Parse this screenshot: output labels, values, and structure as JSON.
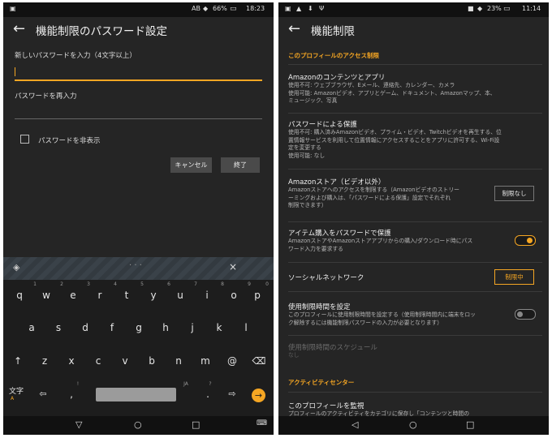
{
  "left": {
    "status": {
      "indicators": "AB",
      "battery": "66%",
      "time": "18:23"
    },
    "title": "機能制限のパスワード設定",
    "new_password_label": "新しいパスワードを入力（4文字以上）",
    "reenter_label": "パスワードを再入力",
    "hide_password_label": "パスワードを非表示",
    "cancel": "キャンセル",
    "finish": "終了",
    "keyboard": {
      "close": "×",
      "row1": [
        "q",
        "w",
        "e",
        "r",
        "t",
        "y",
        "u",
        "i",
        "o",
        "p"
      ],
      "row1_hints": [
        "1",
        "2",
        "3",
        "4",
        "5",
        "6",
        "7",
        "8",
        "9",
        "0"
      ],
      "row2": [
        "a",
        "s",
        "d",
        "f",
        "g",
        "h",
        "j",
        "k",
        "l"
      ],
      "row3": [
        "↑",
        "z",
        "x",
        "c",
        "v",
        "b",
        "n",
        "m",
        "@",
        "⌫"
      ],
      "lang": "文字",
      "lang_sub": "A",
      "comma": ",",
      "comma_hint": "!",
      "period": ".",
      "ja_hint": "JA",
      "question_hint": "?",
      "enter": "→"
    }
  },
  "right": {
    "status": {
      "battery": "23%",
      "time": "11:14"
    },
    "title": "機能制限",
    "section_profile": "このプロフィールのアクセス制限",
    "items": [
      {
        "title": "Amazonのコンテンツとアプリ",
        "desc": [
          "使用不可: ウェブブラウザ、Eメール、連絡先、カレンダー、カメラ",
          "使用可能: Amazonビデオ、アプリとゲーム、ドキュメント、Amazonマップ、本、",
          "ミュージック、写真"
        ]
      },
      {
        "title": "パスワードによる保護",
        "desc": [
          "使用不可: 購入済みAmazonビデオ、プライム・ビデオ、Twitchビデオを再生する、位",
          "置情報サービスを利用して位置情報にアクセスすることをアプリに許可する、Wi-Fi設",
          "定を変更する",
          "使用可能: なし"
        ]
      },
      {
        "title": "Amazonストア（ビデオ以外）",
        "desc": [
          "Amazonストアへのアクセスを制限する（Amazonビデオのストリー",
          "ーミングおよび購入は、「パスワードによる保護」設定でそれぞれ",
          "制限できます）"
        ],
        "button": "制限なし"
      },
      {
        "title": "アイテム購入をパスワードで保護",
        "desc": [
          "AmazonストアやAmazonストアアプリからの購入/ダウンロード時にパス",
          "ワード入力を要求する"
        ]
      },
      {
        "title": "ソーシャルネットワーク",
        "button": "制限中"
      },
      {
        "title": "使用制限時間を設定",
        "desc": [
          "このプロフィールに使用制限時間を設定する（使用制限時間内に端末をロッ",
          "ク解除するには機能制限パスワードの入力が必要となります）"
        ]
      },
      {
        "title": "使用制限時間のスケジュール",
        "desc": [
          "なし"
        ]
      }
    ],
    "section_activity": "アクティビティセンター",
    "monitor_title": "このプロフィールを監視",
    "monitor_desc": "プロフィールのアクティビティをカテゴリに保存し「コンテンツと時間の"
  },
  "colors": {
    "accent": "#f5a623",
    "bg": "#252525"
  }
}
